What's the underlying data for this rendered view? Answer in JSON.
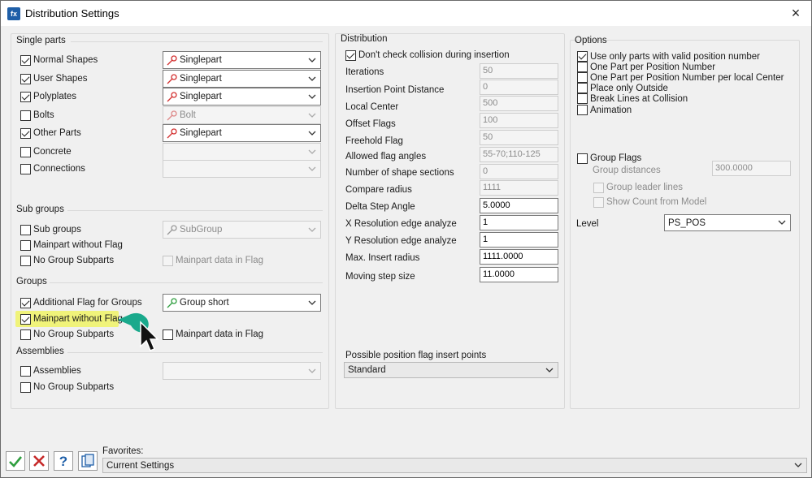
{
  "window": {
    "title": "Distribution Settings",
    "app_icon": "app-logo-icon",
    "close": "×"
  },
  "single_parts": {
    "title": "Single parts",
    "rows": [
      {
        "label": "Normal Shapes",
        "checked": true,
        "combo": "Singlepart"
      },
      {
        "label": "User Shapes",
        "checked": true,
        "combo": "Singlepart"
      },
      {
        "label": "Polyplates",
        "checked": true,
        "combo": "Singlepart"
      },
      {
        "label": "Bolts",
        "checked": false,
        "combo": "Bolt"
      },
      {
        "label": "Other Parts",
        "checked": true,
        "combo": "Singlepart"
      },
      {
        "label": "Concrete",
        "checked": false,
        "combo": ""
      },
      {
        "label": "Connections",
        "checked": false,
        "combo": ""
      }
    ]
  },
  "sub_groups": {
    "title": "Sub groups",
    "sub_groups_label": "Sub groups",
    "sub_groups_combo": "SubGroup",
    "mainpart_without_flag": "Mainpart without Flag",
    "no_group_subparts": "No Group Subparts",
    "mainpart_data_in_flag": "Mainpart data in Flag"
  },
  "groups": {
    "title": "Groups",
    "additional_flag": "Additional Flag for Groups",
    "additional_flag_combo": "Group short",
    "mainpart_without_flag": "Mainpart without Flag",
    "no_group_subparts": "No Group Subparts",
    "mainpart_data_in_flag": "Mainpart data in Flag"
  },
  "assemblies": {
    "title": "Assemblies",
    "assemblies_label": "Assemblies",
    "no_group_subparts": "No Group Subparts"
  },
  "distribution": {
    "title": "Distribution",
    "dont_check_collision": "Don't check collision during insertion",
    "fields": [
      {
        "label": "Iterations",
        "value": "50",
        "enabled": false
      },
      {
        "label": "Insertion Point Distance",
        "value": "0",
        "enabled": false
      },
      {
        "label": "Local Center",
        "value": "500",
        "enabled": false
      },
      {
        "label": "Offset Flags",
        "value": "100",
        "enabled": false
      },
      {
        "label": "Freehold Flag",
        "value": "50",
        "enabled": false
      },
      {
        "label": "Allowed flag angles",
        "value": "55-70;110-125",
        "enabled": false
      },
      {
        "label": "Number of shape sections",
        "value": "0",
        "enabled": false
      },
      {
        "label": "Compare radius",
        "value": "1111",
        "enabled": false
      },
      {
        "label": "Delta Step Angle",
        "value": "5.0000",
        "enabled": true
      },
      {
        "label": "X Resolution edge analyze",
        "value": "1",
        "enabled": true
      },
      {
        "label": "Y Resolution edge analyze",
        "value": "1",
        "enabled": true
      },
      {
        "label": "Max. Insert radius",
        "value": "1111.0000",
        "enabled": true
      },
      {
        "label": "Moving step size",
        "value": "11.0000",
        "enabled": true
      }
    ],
    "insert_points_label": "Possible position flag insert points",
    "insert_points_value": "Standard"
  },
  "options": {
    "title": "Options",
    "checks": [
      {
        "label": "Use only parts with valid position number",
        "checked": true
      },
      {
        "label": "One Part per Position Number",
        "checked": false
      },
      {
        "label": "One Part per Position Number per local Center",
        "checked": false
      },
      {
        "label": "Place only Outside",
        "checked": false
      },
      {
        "label": "Break Lines at Collision",
        "checked": false
      },
      {
        "label": "Animation",
        "checked": false
      }
    ],
    "group_flags": "Group Flags",
    "group_distances_label": "Group distances",
    "group_distances_value": "300.0000",
    "group_leader_lines": "Group leader lines",
    "show_count_from_model": "Show Count from Model",
    "level_label": "Level",
    "level_value": "PS_POS"
  },
  "footer": {
    "favorites_label": "Favorites:",
    "favorites_value": "Current Settings",
    "buttons": [
      "ok-checkmark-icon",
      "cancel-x-icon",
      "help-question-icon",
      "document-copy-icon"
    ]
  },
  "colors": {
    "highlight": "#f0f37a",
    "teal_marker": "#1aa98c",
    "pin_red": "#d32f2f",
    "pin_green": "#2e9e3e"
  }
}
